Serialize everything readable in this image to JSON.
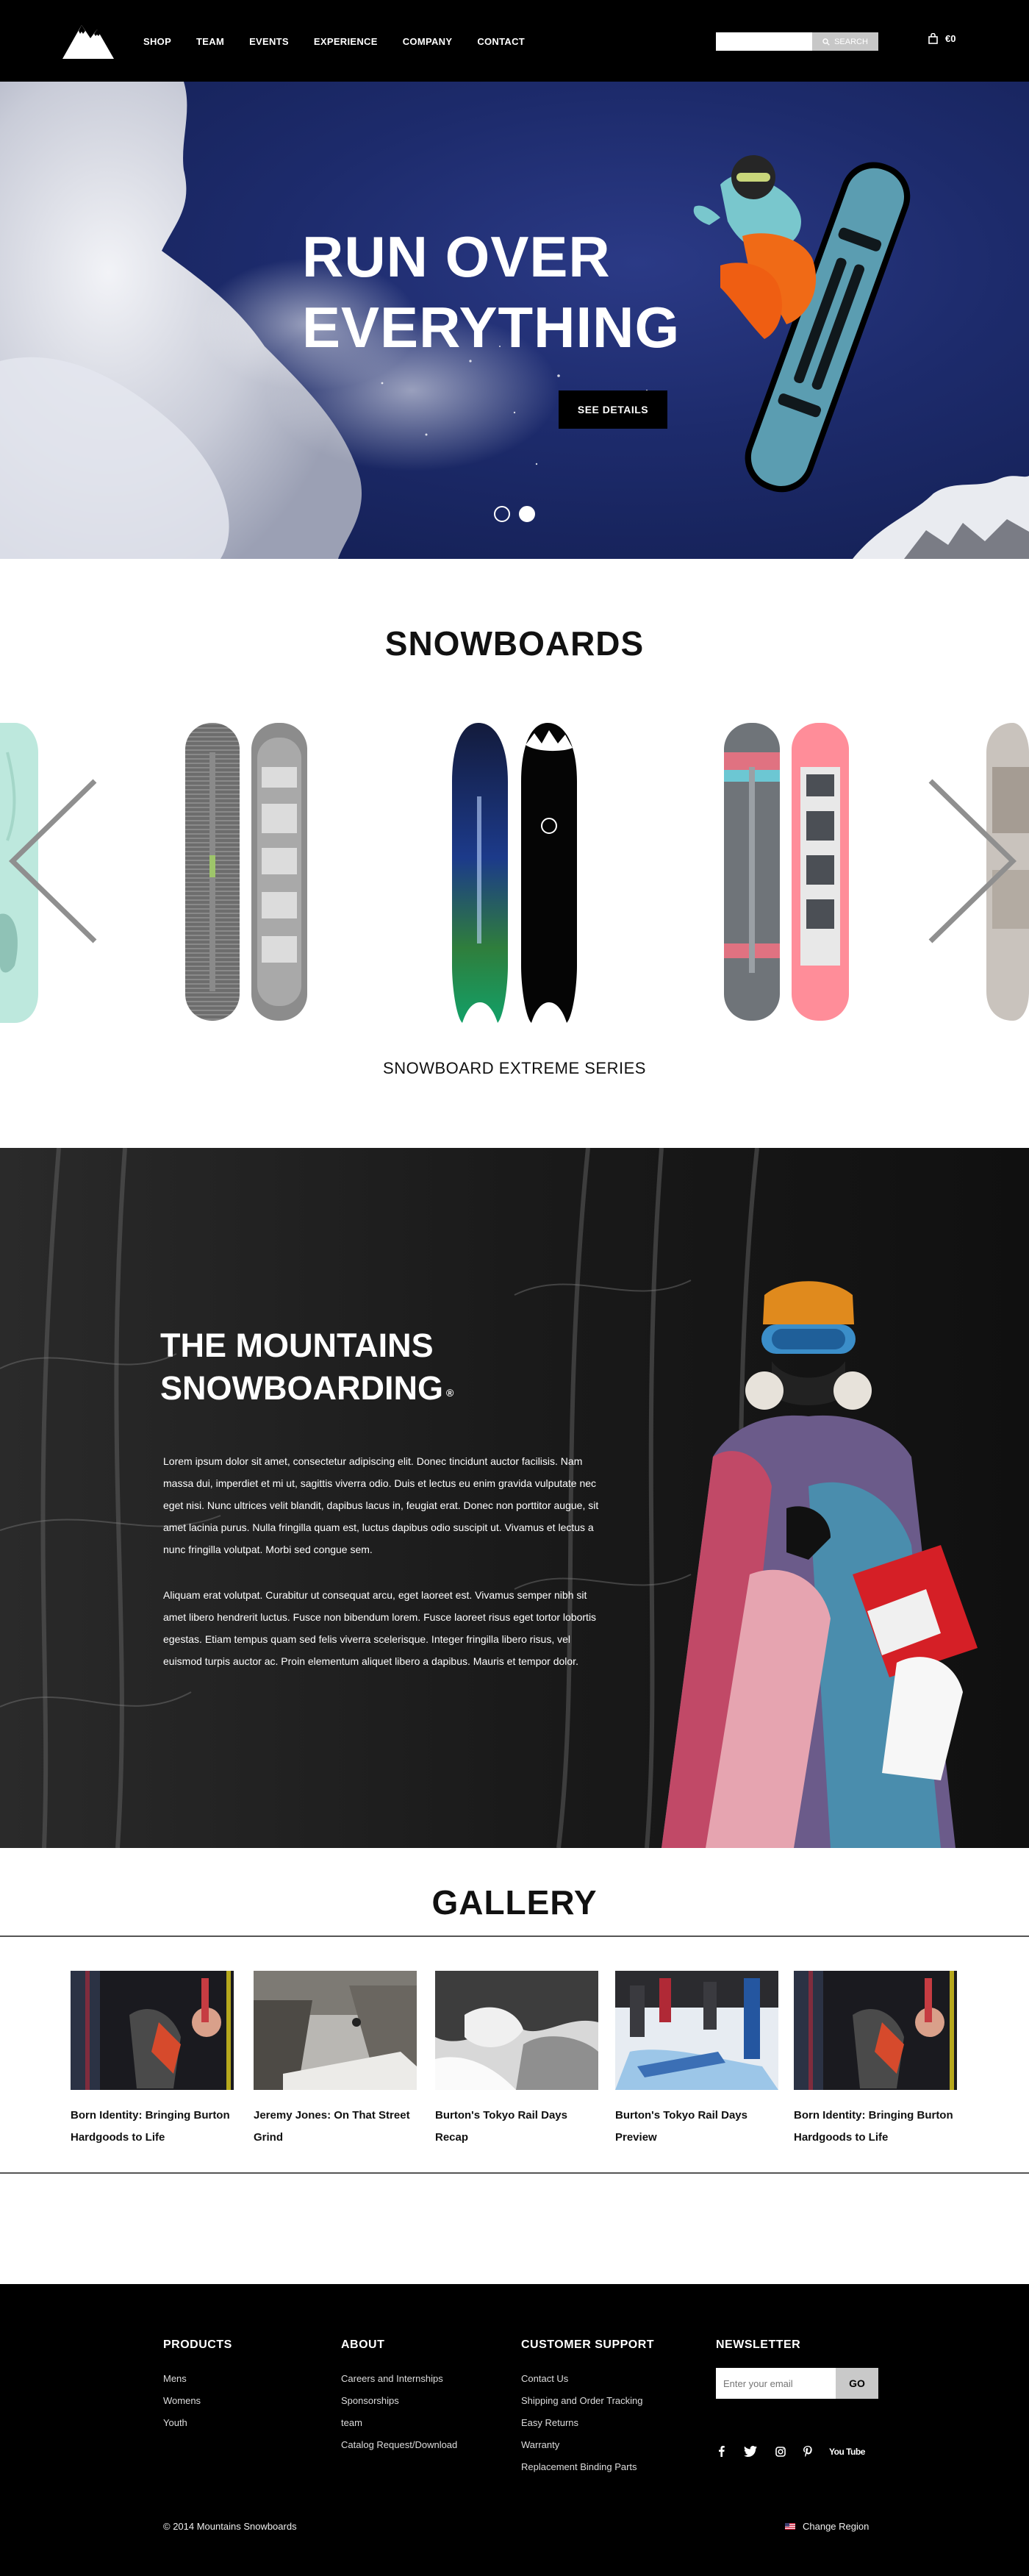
{
  "header": {
    "nav": [
      "SHOP",
      "TEAM",
      "EVENTS",
      "EXPERIENCE",
      "COMPANY",
      "CONTACT"
    ],
    "search": {
      "placeholder": "",
      "button_label": "SEARCH"
    },
    "cart": {
      "amount": "€0"
    }
  },
  "hero": {
    "title_line1": "RUN OVER",
    "title_line2": "EVERYTHING",
    "cta_label": "SEE DETAILS",
    "slides": {
      "count": 2,
      "active_index": 1
    }
  },
  "snowboards": {
    "title": "SNOWBOARDS",
    "series_label": "SNOWBOARD EXTREME SERIES"
  },
  "feature": {
    "title_line1": "THE MOUNTAINS",
    "title_line2": "SNOWBOARDING",
    "trademark": "®",
    "paragraph1": "Lorem ipsum dolor sit amet, consectetur adipiscing elit. Donec tincidunt auctor facilisis. Nam massa dui, imperdiet et mi ut, sagittis viverra odio. Duis et lectus eu enim gravida vulputate nec eget nisi. Nunc ultrices velit blandit, dapibus lacus in, feugiat erat. Donec non porttitor augue, sit amet lacinia purus. Nulla fringilla quam est, luctus dapibus odio suscipit ut. Vivamus et lectus a nunc fringilla volutpat. Morbi sed congue sem.",
    "paragraph2": "Aliquam erat volutpat. Curabitur ut consequat arcu, eget laoreet est. Vivamus semper nibh sit amet libero hendrerit luctus. Fusce non bibendum lorem. Fusce laoreet risus eget tortor lobortis egestas. Etiam tempus quam sed felis viverra scelerisque. Integer fringilla libero risus, vel euismod turpis auctor ac. Proin elementum aliquet libero a dapibus. Mauris et tempor dolor."
  },
  "gallery": {
    "title": "GALLERY",
    "items": [
      {
        "caption": "Born Identity: Bringing Burton Hardgoods to Life"
      },
      {
        "caption": "Jeremy Jones: On That Street Grind"
      },
      {
        "caption": "Burton's Tokyo Rail Days Recap"
      },
      {
        "caption": "Burton's Tokyo Rail Days Preview"
      },
      {
        "caption": "Born Identity: Bringing Burton Hardgoods to Life"
      }
    ]
  },
  "footer": {
    "products": {
      "heading": "PRODUCTS",
      "links": [
        "Mens",
        "Womens",
        "Youth"
      ]
    },
    "about": {
      "heading": "ABOUT",
      "links": [
        "Careers and Internships",
        "Sponsorships",
        "team",
        "Catalog Request/Download"
      ]
    },
    "support": {
      "heading": "CUSTOMER SUPPORT",
      "links": [
        "Contact Us",
        "Shipping and Order Tracking",
        "Easy Returns",
        "Warranty",
        "Replacement Binding Parts"
      ]
    },
    "newsletter": {
      "heading": "NEWSLETTER",
      "placeholder": "Enter your email",
      "button_label": "GO"
    },
    "social": [
      "facebook-icon",
      "twitter-icon",
      "instagram-icon",
      "pinterest-icon",
      "youtube-icon"
    ],
    "youtube_label": "You Tube",
    "copyright": "© 2014 Mountains Snowboards",
    "region_label": "Change Region"
  },
  "colors": {
    "header_bg": "#000000",
    "hero_sky": "#1d2b6c",
    "accent_black": "#000000",
    "search_button": "#c7c7c7"
  }
}
